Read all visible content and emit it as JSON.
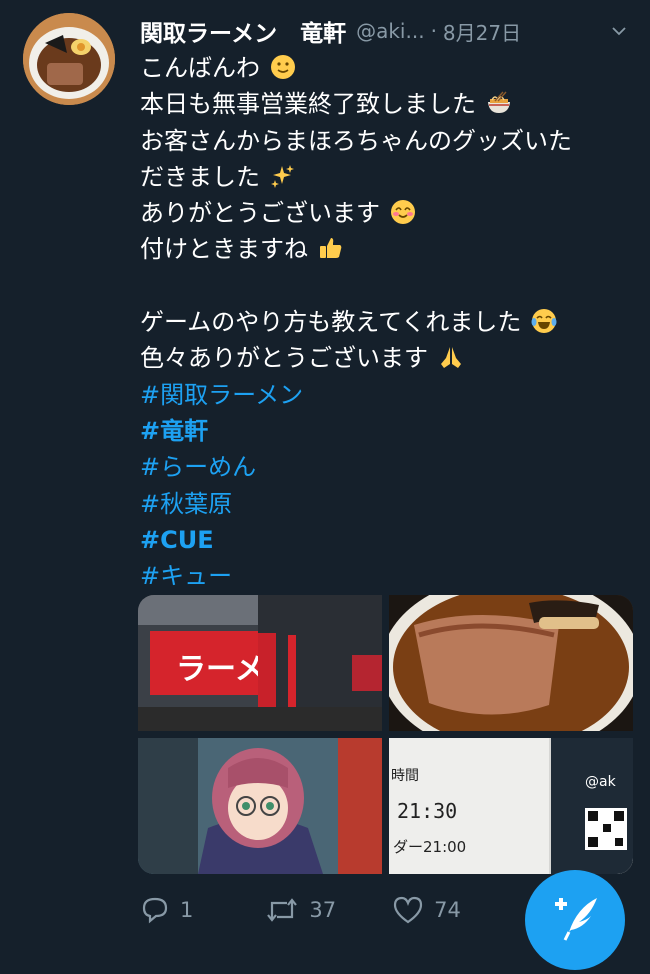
{
  "tweet": {
    "display_name": "関取ラーメン　竜軒",
    "handle": "@aki...",
    "separator": "·",
    "date": "8月27日",
    "lines": {
      "l1": "こんばんわ",
      "l2": "本日も無事営業終了致しました",
      "l3": "お客さんからまほろちゃんのグッズいた",
      "l4": "だきました",
      "l5": "ありがとうございます",
      "l6": "付けときますね",
      "l7": "ゲームのやり方も教えてくれました",
      "l8": "色々ありがとうございます"
    },
    "hashtags": [
      "#関取ラーメン",
      "#竜軒",
      "#らーめん",
      "#秋葉原",
      "#CUE",
      "#キュー"
    ],
    "media": {
      "shop_sign_text": "ラーメ",
      "notice_time_1": "21:30",
      "notice_time_2": "ダー21:00",
      "notice_label": "時間",
      "notice_handle": "@ak"
    },
    "actions": {
      "replies": "1",
      "retweets": "37",
      "likes": "74"
    }
  },
  "colors": {
    "background": "#15202b",
    "secondary_text": "#8899a6",
    "link": "#1da1f2",
    "fab": "#1da1f2"
  },
  "icons": [
    "chevron-down-icon",
    "reply-icon",
    "retweet-icon",
    "like-icon",
    "compose-tweet-icon"
  ]
}
